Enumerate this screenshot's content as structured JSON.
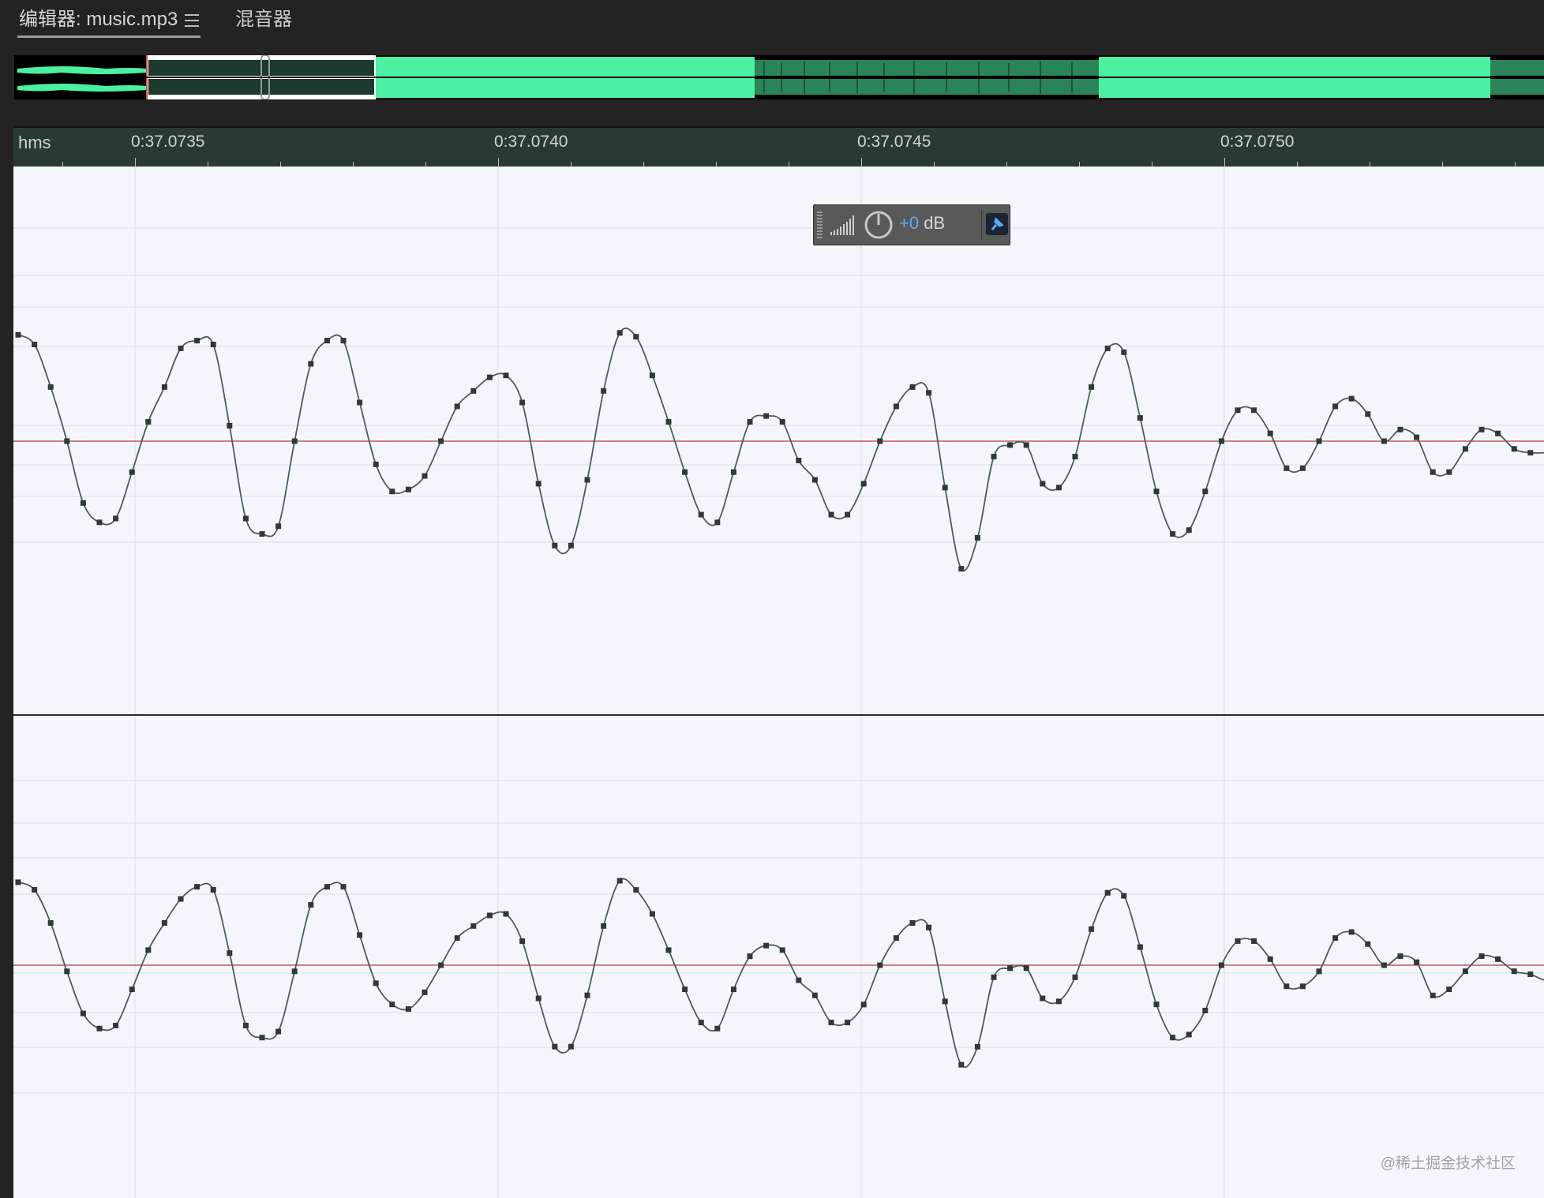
{
  "tabs": {
    "editor_label": "编辑器: music.mp3",
    "mixer_label": "混音器"
  },
  "ruler": {
    "units_label": "hms",
    "ticks": [
      "0:37.0735",
      "0:37.0740",
      "0:37.0745",
      "0:37.0750"
    ]
  },
  "hud": {
    "gain_value": "+0",
    "gain_unit": "dB"
  },
  "colors": {
    "overview_wave": "#4cf0a3",
    "waveform_line": "#4a5e55",
    "sample_marker": "#2f3a34",
    "center_line": "#b23a3a",
    "grid_line": "#dadde6",
    "ruler_bg": "#2a3a33",
    "hud_accent": "#5aaaf5"
  },
  "watermark": "@稀土掘金技术社区"
}
